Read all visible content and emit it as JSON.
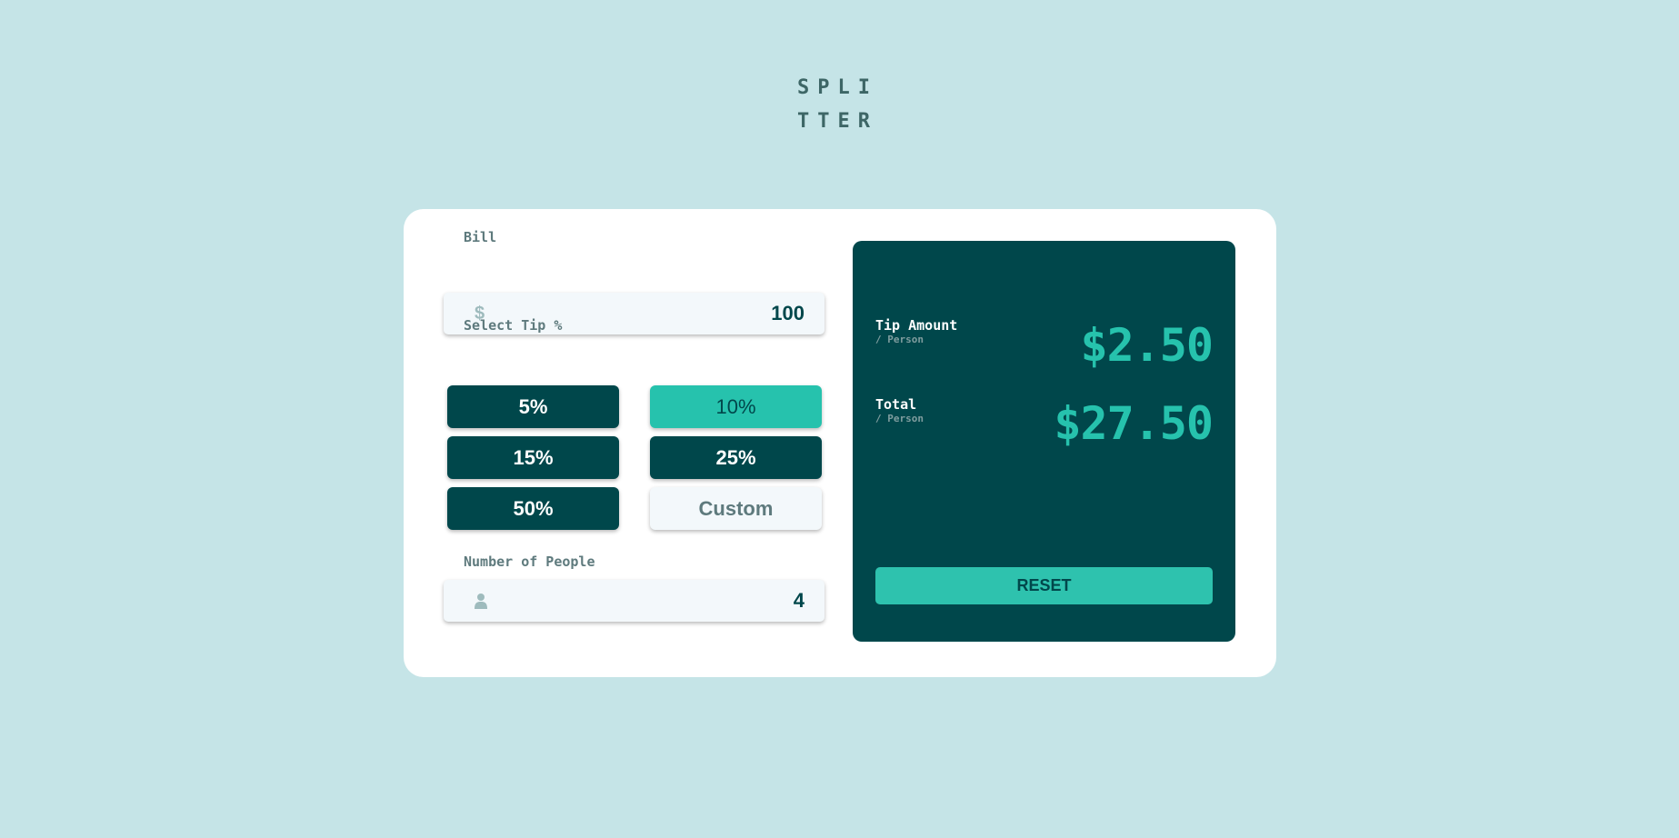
{
  "app": {
    "logo_lines": [
      "SPLI",
      "TTER"
    ]
  },
  "bill": {
    "label": "Bill",
    "icon": "dollar-icon",
    "icon_glyph": "$",
    "value": "100"
  },
  "tip": {
    "label": "Select Tip %",
    "options": [
      {
        "label": "5%",
        "selected": false
      },
      {
        "label": "10%",
        "selected": true
      },
      {
        "label": "15%",
        "selected": false
      },
      {
        "label": "25%",
        "selected": false
      },
      {
        "label": "50%",
        "selected": false
      }
    ],
    "custom_placeholder": "Custom"
  },
  "people": {
    "label": "Number of People",
    "icon": "person-icon",
    "value": "4"
  },
  "results": {
    "tip_amount": {
      "title": "Tip Amount",
      "sub": "/ Person",
      "value": "$2.50"
    },
    "total": {
      "title": "Total",
      "sub": "/ Person",
      "value": "$27.50"
    },
    "reset_label": "RESET"
  },
  "colors": {
    "background": "#c5e4e7",
    "dark_cyan": "#00474b",
    "strong_cyan": "#26c2ad",
    "card": "#ffffff",
    "input_bg": "#f3f8fb"
  }
}
